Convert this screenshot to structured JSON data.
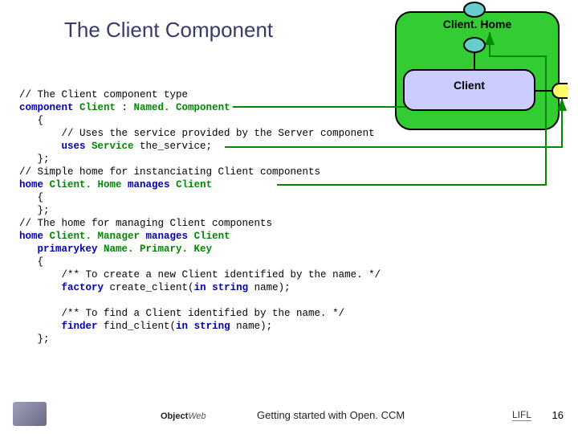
{
  "title": "The Client Component",
  "diagram": {
    "home_label": "Client. Home",
    "client_label": "Client"
  },
  "code": {
    "c01": "// The Client component type",
    "c02_a": "component ",
    "c02_b": "Client ",
    "c02_c": ": ",
    "c02_d": "Named. Component",
    "c03": "   {",
    "c04": "       // Uses the service provided by the Server component",
    "c05_a": "       ",
    "c05_b": "uses ",
    "c05_c": "Service ",
    "c05_d": "the_service;",
    "c06": "   };",
    "c07": "// Simple home for instanciating Client components",
    "c08_a": "home ",
    "c08_b": "Client. Home ",
    "c08_c": "manages ",
    "c08_d": "Client",
    "c09": "   {",
    "c10": "   };",
    "c11": "// The home for managing Client components",
    "c12_a": "home ",
    "c12_b": "Client. Manager ",
    "c12_c": "manages ",
    "c12_d": "Client",
    "c13_a": "   ",
    "c13_b": "primarykey ",
    "c13_c": "Name. Primary. Key",
    "c14": "   {",
    "c15": "       /** To create a new Client identified by the name. */",
    "c16_a": "       ",
    "c16_b": "factory ",
    "c16_c": "create_client(",
    "c16_d": "in ",
    "c16_e": "string ",
    "c16_f": "name);",
    "c17": "",
    "c18": "       /** To find a Client identified by the name. */",
    "c19_a": "       ",
    "c19_b": "finder ",
    "c19_c": "find_client(",
    "c19_d": "in ",
    "c19_e": "string ",
    "c19_f": "name);",
    "c20": "   };"
  },
  "footer": {
    "objectweb": "Object",
    "objectweb2": "Web",
    "text": "Getting started with Open. CCM",
    "lifl": "LIFL",
    "page": "16"
  }
}
